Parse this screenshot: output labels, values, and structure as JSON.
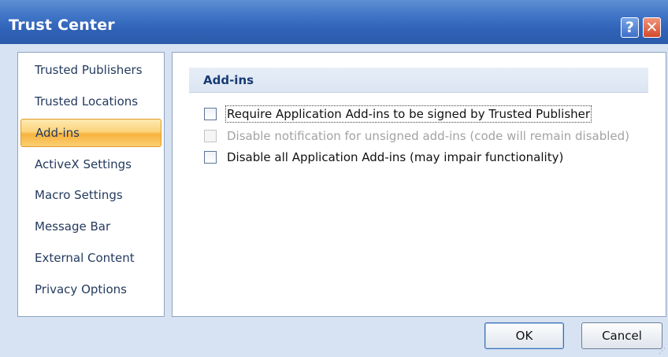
{
  "window": {
    "title": "Trust Center",
    "help_glyph": "?",
    "close_glyph": "✕"
  },
  "sidebar": {
    "items": [
      {
        "label": "Trusted Publishers",
        "selected": false
      },
      {
        "label": "Trusted Locations",
        "selected": false
      },
      {
        "label": "Add-ins",
        "selected": true
      },
      {
        "label": "ActiveX Settings",
        "selected": false
      },
      {
        "label": "Macro Settings",
        "selected": false
      },
      {
        "label": "Message Bar",
        "selected": false
      },
      {
        "label": "External Content",
        "selected": false
      },
      {
        "label": "Privacy Options",
        "selected": false
      }
    ]
  },
  "main": {
    "section_title": "Add-ins",
    "options": [
      {
        "label": "Require Application Add-ins to be signed by Trusted Publisher",
        "checked": false,
        "enabled": true
      },
      {
        "label": "Disable notification for unsigned add-ins (code will remain disabled)",
        "checked": false,
        "enabled": false
      },
      {
        "label": "Disable all Application Add-ins (may impair functionality)",
        "checked": false,
        "enabled": true
      }
    ]
  },
  "footer": {
    "ok_label": "OK",
    "cancel_label": "Cancel"
  },
  "colors": {
    "title_bar": "#3e73c6",
    "selected_item": "#fcd47c",
    "section_header_text": "#173c74"
  }
}
